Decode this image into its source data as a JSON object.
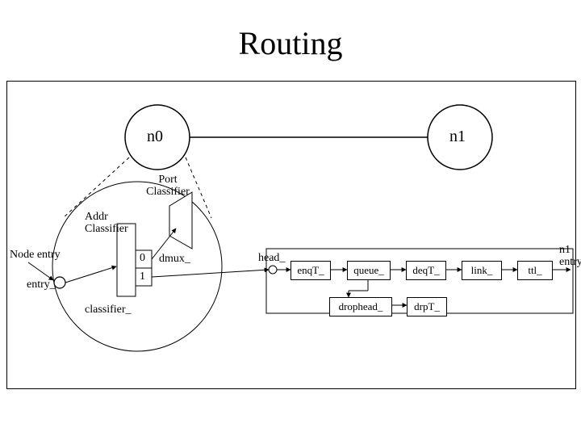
{
  "title": "Routing",
  "nodes": {
    "n0": "n0",
    "n1": "n1"
  },
  "labels": {
    "port_classifier": "Port\nClassifier",
    "addr_classifier": "Addr\nClassifier",
    "node_entry": "Node entry",
    "entry_": "entry_",
    "dmux_": "dmux_",
    "classifier_": "classifier_",
    "head_": "head_",
    "n1_entry": "n1\nentry_"
  },
  "addr_ports": {
    "p0": "0",
    "p1": "1"
  },
  "pipeline": {
    "enqT": "enqT_",
    "queue": "queue_",
    "deqT": "deqT_",
    "link": "link_",
    "ttl": "ttl_",
    "drophead": "drophead_",
    "drpT": "drpT_"
  }
}
